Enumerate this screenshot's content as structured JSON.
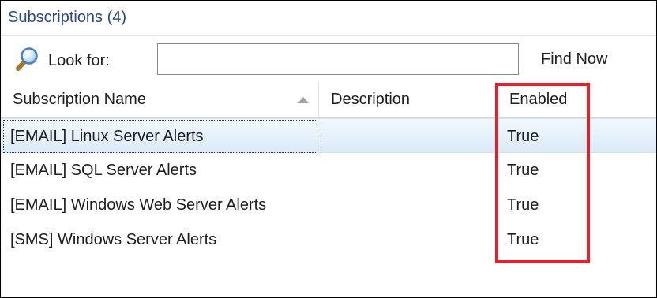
{
  "panel": {
    "title": "Subscriptions (4)"
  },
  "search": {
    "label": "Look for:",
    "value": "",
    "placeholder": "",
    "find_now_label": "Find Now",
    "icon": "magnifier-icon"
  },
  "columns": [
    {
      "label": "Subscription Name",
      "sorted": "ascending"
    },
    {
      "label": "Description"
    },
    {
      "label": "Enabled"
    }
  ],
  "rows": [
    {
      "name": "[EMAIL] Linux Server Alerts",
      "description": "",
      "enabled": "True",
      "selected": true
    },
    {
      "name": "[EMAIL] SQL Server Alerts",
      "description": "",
      "enabled": "True",
      "selected": false
    },
    {
      "name": "[EMAIL] Windows Web Server Alerts",
      "description": "",
      "enabled": "True",
      "selected": false
    },
    {
      "name": "[SMS] Windows Server Alerts",
      "description": "",
      "enabled": "True",
      "selected": false
    }
  ],
  "colors": {
    "title": "#2b4a7c",
    "selection": "#dbeaf8",
    "annotation_box": "#e4202b"
  }
}
